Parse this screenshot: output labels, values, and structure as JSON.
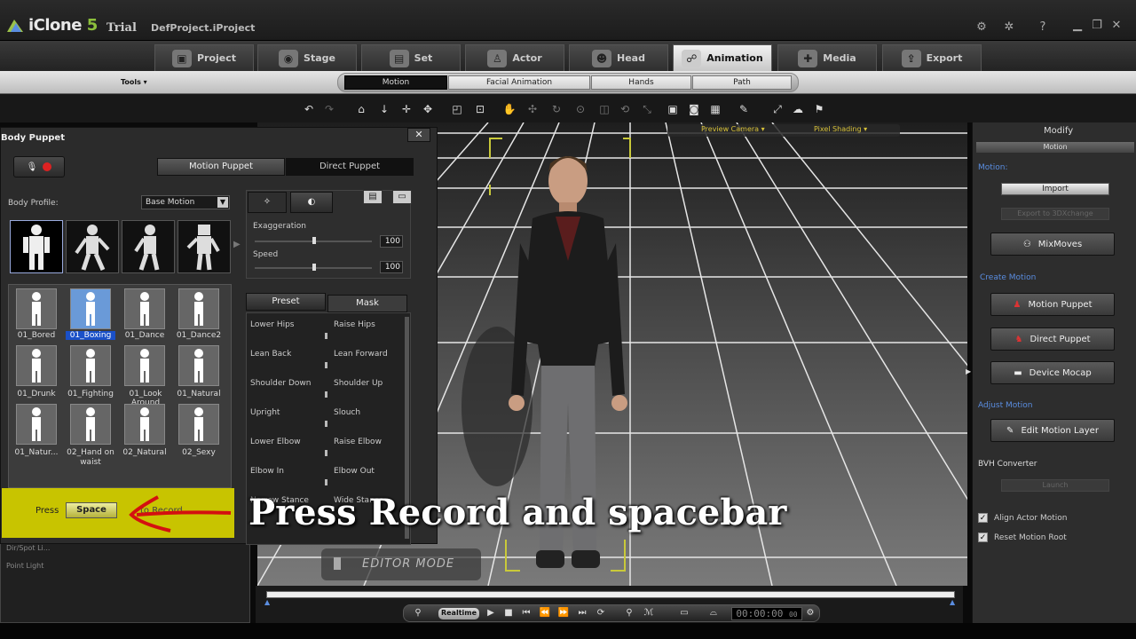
{
  "app": {
    "name": "iClone",
    "edition": "Trial",
    "project": "DefProject.iProject",
    "window_icons": [
      "network-icon",
      "settings-icon",
      "help-icon",
      "restore-icon",
      "close-icon"
    ]
  },
  "main_tabs": [
    {
      "label": "Project",
      "icon": "project-icon"
    },
    {
      "label": "Stage",
      "icon": "stage-icon"
    },
    {
      "label": "Set",
      "icon": "set-icon"
    },
    {
      "label": "Actor",
      "icon": "actor-icon"
    },
    {
      "label": "Head",
      "icon": "head-icon"
    },
    {
      "label": "Animation",
      "icon": "animation-icon",
      "active": true
    },
    {
      "label": "Media",
      "icon": "media-icon"
    },
    {
      "label": "Export",
      "icon": "export-icon"
    }
  ],
  "tools_label": "Tools ▾",
  "sub_tabs": [
    {
      "label": "Motion",
      "active": true
    },
    {
      "label": "Facial Animation"
    },
    {
      "label": "Hands"
    },
    {
      "label": "Path"
    }
  ],
  "viewport": {
    "preview_camera": "Preview Camera",
    "pixel_shading": "Pixel Shading",
    "editor_mode": "EDITOR MODE"
  },
  "left_panel_rows": [
    "Dir/Spot Li...",
    "Point Light"
  ],
  "body_puppet": {
    "title": "Body Puppet",
    "mode_tabs": [
      "Motion Puppet",
      "Direct Puppet"
    ],
    "active_mode": "Motion Puppet",
    "body_profile_label": "Body Profile:",
    "body_profile_value": "Base Motion",
    "gallery": [
      {
        "label": "01_Bored"
      },
      {
        "label": "01_Boxing",
        "selected": true
      },
      {
        "label": "01_Dance"
      },
      {
        "label": "01_Dance2"
      },
      {
        "label": "01_Drunk"
      },
      {
        "label": "01_Fighting"
      },
      {
        "label": "01_Look Around"
      },
      {
        "label": "01_Natural"
      },
      {
        "label": "01_Natur..."
      },
      {
        "label": "02_Hand on waist"
      },
      {
        "label": "02_Natural"
      },
      {
        "label": "02_Sexy"
      }
    ],
    "exaggeration_label": "Exaggeration",
    "exaggeration_value": "100",
    "speed_label": "Speed",
    "speed_value": "100",
    "preset_tabs": [
      "Preset",
      "Mask"
    ],
    "presets": [
      [
        "Lower Hips",
        "Raise Hips"
      ],
      [
        "Lean Back",
        "Lean Forward"
      ],
      [
        "Shoulder Down",
        "Shoulder Up"
      ],
      [
        "Upright",
        "Slouch"
      ],
      [
        "Lower Elbow",
        "Raise Elbow"
      ],
      [
        "Elbow In",
        "Elbow Out"
      ],
      [
        "Narrow Stance",
        "Wide Stance"
      ]
    ],
    "press_label": "Press",
    "space_key": "Space",
    "to_record": "to Record"
  },
  "caption": "Press Record and spacebar",
  "right_panel": {
    "title": "Modify",
    "dropdown": "Motion",
    "motion_label": "Motion:",
    "import_button": "Import",
    "export_button": "Export to 3DXchange",
    "mixmoves_button": "MixMoves",
    "create_motion_label": "Create Motion",
    "motion_puppet_button": "Motion Puppet",
    "direct_puppet_button": "Direct Puppet",
    "device_mocap_button": "Device Mocap",
    "adjust_motion_label": "Adjust Motion",
    "edit_motion_layer_button": "Edit Motion Layer",
    "bvh_converter_label": "BVH Converter",
    "bvh_launch_button": "Launch",
    "align_actor_motion": "Align Actor Motion",
    "reset_motion_root": "Reset Motion Root"
  },
  "timeline": {
    "realtime_label": "Realtime",
    "timecode": "00:00:00",
    "counter": "00"
  }
}
